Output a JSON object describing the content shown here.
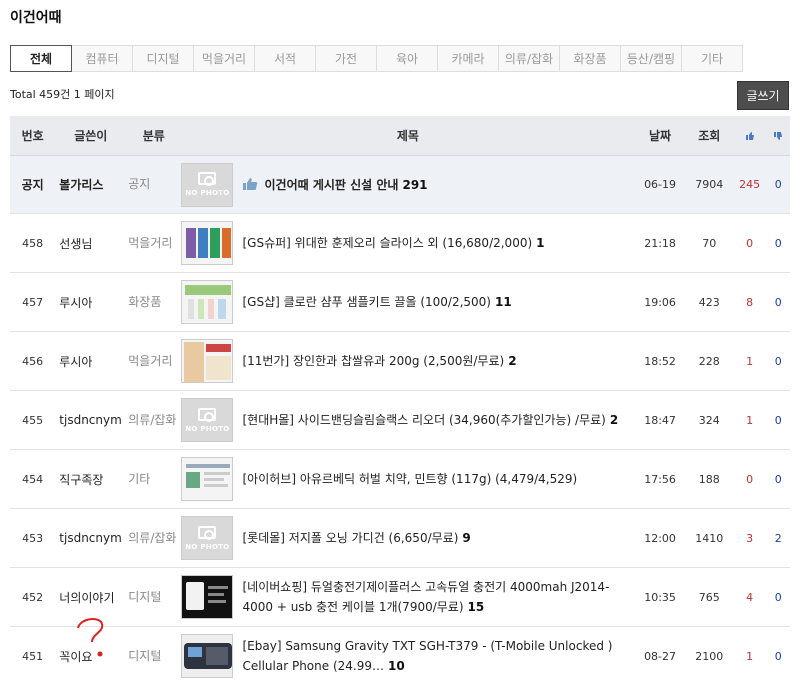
{
  "board": {
    "title": "이건어때"
  },
  "tabs": [
    {
      "label": "전체",
      "active": true
    },
    {
      "label": "컴퓨터"
    },
    {
      "label": "디지털"
    },
    {
      "label": "먹을거리"
    },
    {
      "label": "서적"
    },
    {
      "label": "가전"
    },
    {
      "label": "육아"
    },
    {
      "label": "카메라"
    },
    {
      "label": "의류/잡화"
    },
    {
      "label": "화장품"
    },
    {
      "label": "등산/캠핑"
    },
    {
      "label": "기타"
    }
  ],
  "summary": {
    "total_text": "Total 459건 1 페이지"
  },
  "write_button": {
    "label": "글쓰기"
  },
  "columns": {
    "num": "번호",
    "author": "글쓴이",
    "category": "분류",
    "title": "제목",
    "date": "날짜",
    "views": "조회"
  },
  "notice": {
    "num": "공지",
    "author": "볼가리스",
    "category": "공지",
    "thumb": "NO PHOTO",
    "title": "이건어때 게시판 신설 안내",
    "comments": "291",
    "date": "06-19",
    "views": "7904",
    "up": "245",
    "down": "0"
  },
  "posts": [
    {
      "num": "458",
      "author": "선생님",
      "category": "먹을거리",
      "thumb": "image",
      "title": "[GS슈퍼] 위대한 훈제오리 슬라이스 외 (16,680/2,000)",
      "comments": "1",
      "date": "21:18",
      "views": "70",
      "up": "0",
      "down": "0"
    },
    {
      "num": "457",
      "author": "루시아",
      "category": "화장품",
      "thumb": "image",
      "title": "[GS샵] 클로란 샴푸 샘플키트 끌올 (100/2,500)",
      "comments": "11",
      "date": "19:06",
      "views": "423",
      "up": "8",
      "down": "0"
    },
    {
      "num": "456",
      "author": "루시아",
      "category": "먹을거리",
      "thumb": "image",
      "title": "[11번가] 장인한과 찹쌀유과 200g (2,500원/무료)",
      "comments": "2",
      "date": "18:52",
      "views": "228",
      "up": "1",
      "down": "0"
    },
    {
      "num": "455",
      "author": "tjsdncnym",
      "category": "의류/잡화",
      "thumb": "NO PHOTO",
      "title": "[현대H몰] 사이드밴딩슬림슬랙스 리오더 (34,960(추가할인가능) /무료)",
      "comments": "2",
      "date": "18:47",
      "views": "324",
      "up": "1",
      "down": "0"
    },
    {
      "num": "454",
      "author": "직구족장",
      "category": "기타",
      "thumb": "image",
      "title": "[아이허브] 아유르베딕 허벌 치약, 민트향 (117g) (4,479/4,529)",
      "comments": "",
      "date": "17:56",
      "views": "188",
      "up": "0",
      "down": "0"
    },
    {
      "num": "453",
      "author": "tjsdncnym",
      "category": "의류/잡화",
      "thumb": "NO PHOTO",
      "title": "[롯데몰] 저지폴 오닝 가디건 (6,650/무료)",
      "comments": "9",
      "date": "12:00",
      "views": "1410",
      "up": "3",
      "down": "2"
    },
    {
      "num": "452",
      "author": "너의이야기",
      "category": "디지털",
      "thumb": "image",
      "title": "[네이버쇼핑] 듀얼충전기제이플러스 고속듀얼 충전기 4000mah J2014-4000 + usb 충전 케이블 1개(7900/무료)",
      "comments": "15",
      "date": "10:35",
      "views": "765",
      "up": "4",
      "down": "0"
    },
    {
      "num": "451",
      "author": "꼭이요",
      "category": "디지털",
      "thumb": "image",
      "title": "[Ebay] Samsung Gravity TXT SGH-T379 - (T-Mobile Unlocked ) Cellular Phone (24.99…",
      "comments": "10",
      "date": "08-27",
      "views": "2100",
      "up": "1",
      "down": "0"
    }
  ],
  "colors": {
    "header_bg": "#e9ebef",
    "notice_bg": "#eef1f5",
    "up": "#b33333",
    "down": "#1a3fa6",
    "write_bg": "#4d4d4d"
  }
}
